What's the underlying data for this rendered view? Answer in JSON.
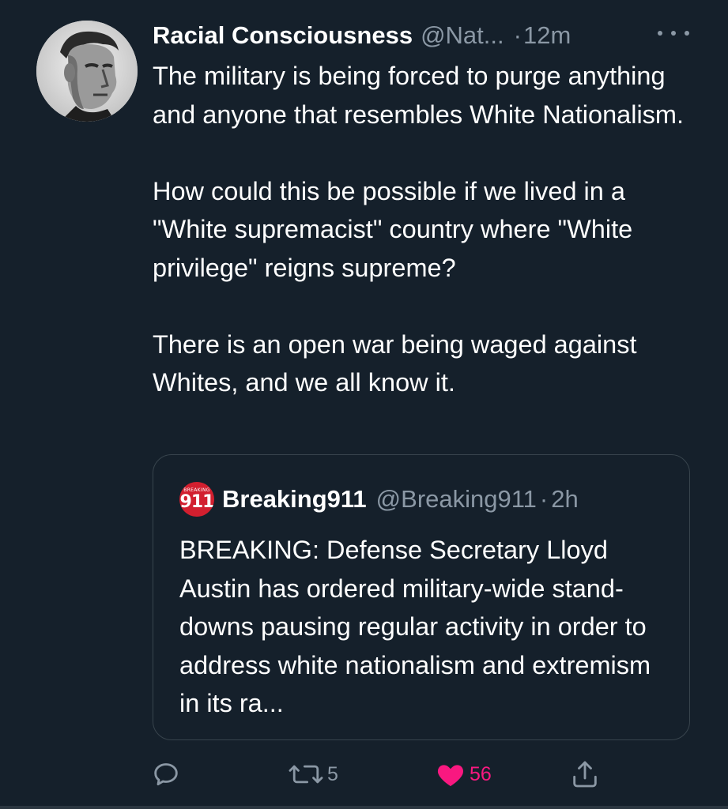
{
  "tweet": {
    "author": {
      "display_name": "Racial Consciousness",
      "handle": "@Nat...",
      "separator": "·",
      "time": "12m",
      "avatar": "avatar-portrait-bw"
    },
    "more_icon": "more-horizontal-icon",
    "paragraphs": [
      "The military is being forced to purge anything and anyone that resembles White Nationalism.",
      "How could this be possible if we lived in a \"White supremacist\" country where \"White privilege\" reigns supreme?",
      "There is an open war being waged against Whites, and we all know it."
    ],
    "quote": {
      "avatar": {
        "icon": "breaking911-logo",
        "small_text": "BREAKING",
        "big_text": "911",
        "color": "#d21f2f"
      },
      "display_name": "Breaking911",
      "handle": "@Breaking911",
      "separator": "·",
      "time": "2h",
      "text": "BREAKING: Defense Secretary Lloyd Austin has ordered military-wide stand-downs pausing regular activity in order to address white nationalism and extremism in its ra..."
    },
    "actions": {
      "reply": {
        "icon": "reply-icon",
        "count": ""
      },
      "retweet": {
        "icon": "retweet-icon",
        "count": "5"
      },
      "like": {
        "icon": "heart-icon",
        "count": "56",
        "liked": true,
        "color": "#f91880"
      },
      "share": {
        "icon": "share-icon",
        "count": ""
      }
    }
  },
  "colors": {
    "background": "#15202b",
    "secondary_text": "#8b98a5",
    "border": "#38444d"
  }
}
